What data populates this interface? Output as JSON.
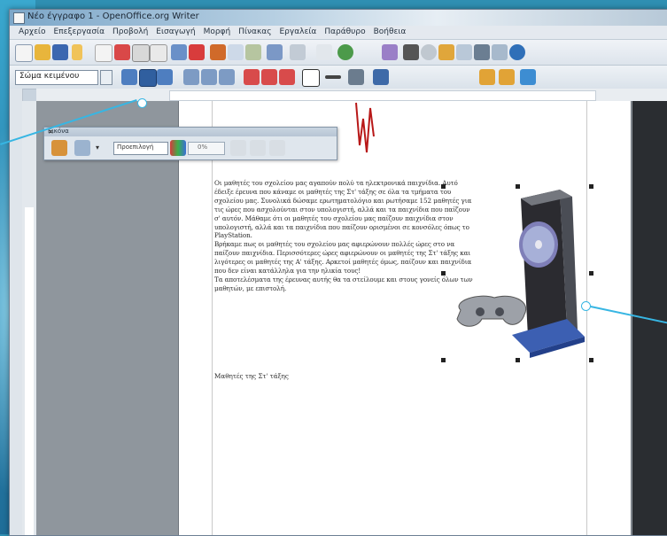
{
  "window": {
    "title": "Νέο έγγραφο 1 - OpenOffice.org Writer"
  },
  "menubar": {
    "items": [
      "Αρχείο",
      "Επεξεργασία",
      "Προβολή",
      "Εισαγωγή",
      "Μορφή",
      "Πίνακας",
      "Εργαλεία",
      "Παράθυρο",
      "Βοήθεια"
    ]
  },
  "format_toolbar": {
    "paragraph_style": "Σώμα κειμένου"
  },
  "picture_toolbar": {
    "title": "Εικόνα",
    "close_glyph": "×",
    "filter_mode": "Προεπιλογή",
    "transparency": "0%"
  },
  "document": {
    "paragraph1": "Οι μαθητές του σχολείου μας αγαπούν πολύ τα ηλεκτρονικά παιχνίδια. Αυτό έδειξε έρευνα που κάναμε οι μαθητές της Στ' τάξης σε όλα τα τμήματα του σχολείου μας. Συνολικά δώσαμε ερωτηματολόγιο και ρωτήσαμε 152 μαθητές για τις ώρες που ασχολούνται στον υπολογιστή, αλλά και τα παιχνίδια που παίζουν σ' αυτόν. Μάθαμε ότι οι μαθητές του σχολείου μας παίζουν παιχνίδια στον υπολογιστή, αλλά και τα παιχνίδια που παίζουν ορισμένοι σε κονσόλες όπως το PlayStation.",
    "paragraph2": "Βρήκαμε πως οι μαθητές του σχολείου μας αφιερώνουν πολλές ώρες στο να παίζουν παιχνίδια. Περισσότερες ώρες αφιερώνουν οι μαθητές της Στ' τάξης και λιγότερες οι μαθητές της Α' τάξης. Αρκετοί μαθητές όμως, παίζουν και παιχνίδια που δεν είναι κατάλληλα για την ηλικία τους!",
    "paragraph3": "Τα αποτελέσματα της έρευνας αυτής θα τα στείλουμε και στους γονείς όλων των μαθητών, με επιστολή.",
    "signature": "Μαθητές της Στ' τάξης"
  },
  "colors": {
    "accent": "#37b6e3",
    "page": "#ffffff",
    "workspace": "#8f969d"
  }
}
